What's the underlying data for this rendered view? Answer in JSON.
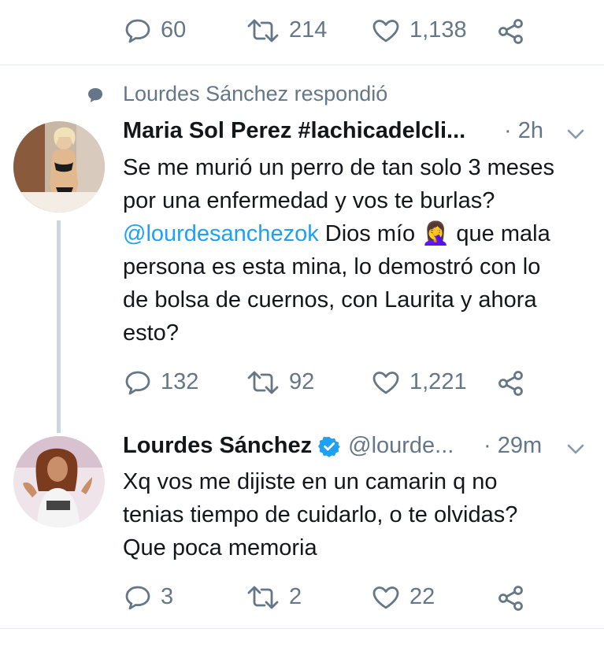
{
  "top_actions": {
    "reply_count": "60",
    "retweet_count": "214",
    "like_count": "1,138"
  },
  "context": {
    "text": "Lourdes Sánchez respondió"
  },
  "tweet1": {
    "author_name": "Maria Sol Perez #lachicadelcli...",
    "time": "· 2h",
    "text_part1": "Se me murió un perro de tan solo 3 meses por una enfermedad y vos te burlas? ",
    "mention": "@lourdesanchezok",
    "text_part2": " Dios mío 🤦‍♀️ que mala persona es esta mina, lo demostró con lo de bolsa de cuernos, con Laurita y ahora esto?",
    "reply_count": "132",
    "retweet_count": "92",
    "like_count": "1,221"
  },
  "tweet2": {
    "author_name": "Lourdes Sánchez",
    "handle": "@lourde...",
    "time": "· 29m",
    "text": "Xq vos me dijiste en un camarin q no tenias tiempo de cuidarlo, o te olvidas? Que poca memoria",
    "reply_count": "3",
    "retweet_count": "2",
    "like_count": "22"
  },
  "colors": {
    "muted": "#657786",
    "link": "#1da1f2",
    "verified": "#1da1f2",
    "divider": "#e6ecf0",
    "thread_line": "#ccd6dd"
  }
}
